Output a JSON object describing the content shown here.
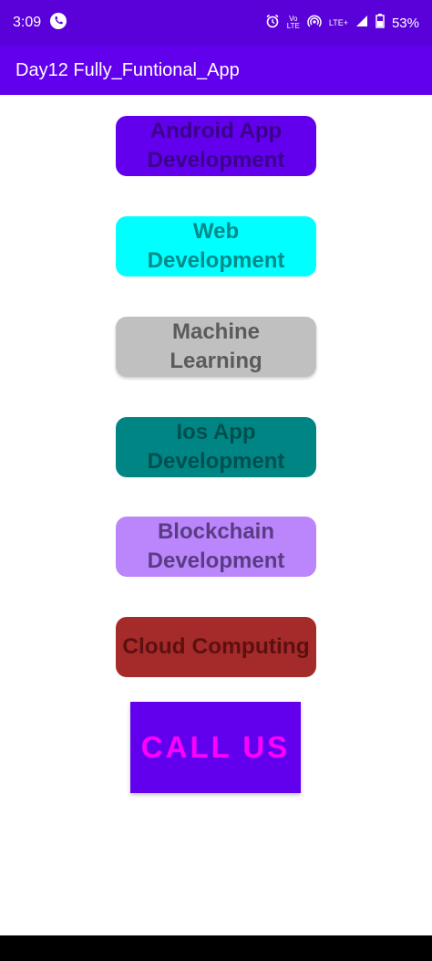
{
  "status_bar": {
    "time": "3:09",
    "network": "LTE+",
    "volte_top": "Vo",
    "volte_bottom": "LTE",
    "battery": "53%"
  },
  "app_bar": {
    "title": "Day12 Fully_Funtional_App"
  },
  "buttons": [
    {
      "line1": "Android App",
      "line2": "Development",
      "bg": "#6200ee",
      "fg": "#3a0088"
    },
    {
      "line1": "Web",
      "line2": "Development",
      "bg": "#00ffff",
      "fg": "#008a8a"
    },
    {
      "line1": "Machine",
      "line2": "Learning",
      "bg": "#c0c0c0",
      "fg": "#5b5b5b"
    },
    {
      "line1": "Ios App",
      "line2": "Development",
      "bg": "#008585",
      "fg": "#004f4f"
    },
    {
      "line1": "Blockchain",
      "line2": "Development",
      "bg": "#bb86fc",
      "fg": "#5a3c85"
    },
    {
      "line1": "Cloud Computing",
      "line2": "",
      "bg": "#a52a2a",
      "fg": "#5c1010"
    }
  ],
  "call_button": {
    "label": "CALL US",
    "bg": "#6200ee",
    "fg": "#ff00ff"
  }
}
